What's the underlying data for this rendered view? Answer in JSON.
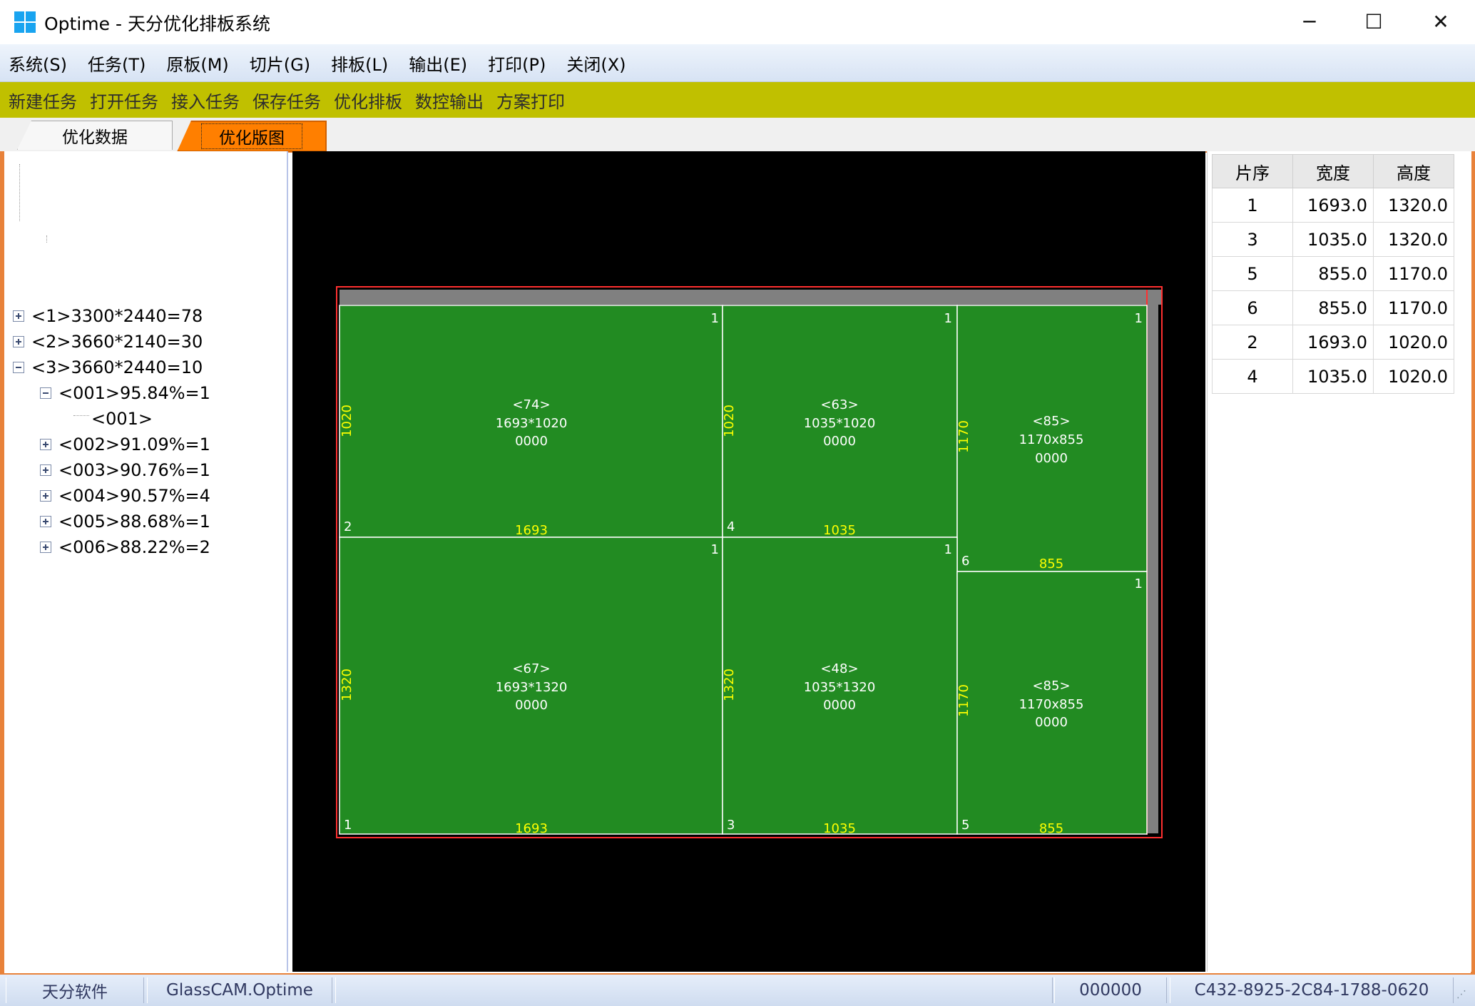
{
  "window": {
    "title": "Optime - 天分优化排板系统",
    "controls": [
      "─",
      "☐",
      "✕"
    ]
  },
  "menu": [
    "系统(S)",
    "任务(T)",
    "原板(M)",
    "切片(G)",
    "排板(L)",
    "输出(E)",
    "打印(P)",
    "关闭(X)"
  ],
  "toolbar": [
    "新建任务",
    "打开任务",
    "接入任务",
    "保存任务",
    "优化排板",
    "数控输出",
    "方案打印"
  ],
  "tabs": [
    {
      "label": "优化数据",
      "active": false
    },
    {
      "label": "优化版图",
      "active": true
    }
  ],
  "tree": [
    {
      "label": "<1>3300*2440=78",
      "expander": "plus"
    },
    {
      "label": "<2>3660*2140=30",
      "expander": "plus"
    },
    {
      "label": "<3>3660*2440=10",
      "expander": "minus"
    },
    {
      "label": "<001>95.84%=1",
      "expander": "minus"
    },
    {
      "label": "<001>",
      "expander": "none"
    },
    {
      "label": "<002>91.09%=1",
      "expander": "plus"
    },
    {
      "label": "<003>90.76%=1",
      "expander": "plus"
    },
    {
      "label": "<004>90.57%=4",
      "expander": "plus"
    },
    {
      "label": "<005>88.68%=1",
      "expander": "plus"
    },
    {
      "label": "<006>88.22%=2",
      "expander": "plus"
    }
  ],
  "layout": {
    "colors": {
      "canvas": "#000000",
      "piece": "#228b22",
      "trim": "#808080",
      "cut_line": "#ffffff",
      "border": "#ff3030",
      "dimension": "#ffff00"
    },
    "pieces": [
      {
        "id": "<74>",
        "size": "1693*1020",
        "code": "0000",
        "width_label": "1693",
        "height_label": "1020",
        "seq": "2",
        "count": "1"
      },
      {
        "id": "<63>",
        "size": "1035*1020",
        "code": "0000",
        "width_label": "1035",
        "height_label": "1020",
        "seq": "4",
        "count": "1"
      },
      {
        "id": "<85>",
        "size": "1170x855",
        "code": "0000",
        "width_label": "855",
        "height_label": "1170",
        "seq": "6",
        "count": "1"
      },
      {
        "id": "<67>",
        "size": "1693*1320",
        "code": "0000",
        "width_label": "1693",
        "height_label": "1320",
        "seq": "1",
        "count": "1"
      },
      {
        "id": "<48>",
        "size": "1035*1320",
        "code": "0000",
        "width_label": "1035",
        "height_label": "1320",
        "seq": "3",
        "count": "1"
      },
      {
        "id": "<85>",
        "size": "1170x855",
        "code": "0000",
        "width_label": "855",
        "height_label": "1170",
        "seq": "5",
        "count": "1"
      }
    ]
  },
  "table": {
    "headers": [
      "片序",
      "宽度",
      "高度"
    ],
    "rows": [
      [
        "1",
        "1693.0",
        "1320.0"
      ],
      [
        "3",
        "1035.0",
        "1320.0"
      ],
      [
        "5",
        "855.0",
        "1170.0"
      ],
      [
        "6",
        "855.0",
        "1170.0"
      ],
      [
        "2",
        "1693.0",
        "1020.0"
      ],
      [
        "4",
        "1035.0",
        "1020.0"
      ]
    ]
  },
  "status": [
    "天分软件",
    "GlassCAM.Optime",
    "000000",
    "C432-8925-2C84-1788-0620"
  ]
}
